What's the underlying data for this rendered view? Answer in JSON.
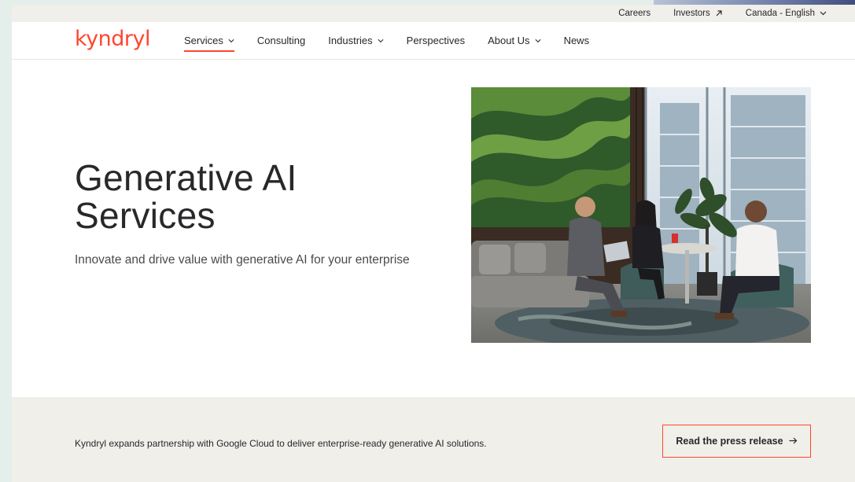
{
  "utility_nav": {
    "careers": "Careers",
    "investors": "Investors",
    "locale": "Canada - English"
  },
  "brand": {
    "logo_text": "kyndryl"
  },
  "main_nav": {
    "items": [
      {
        "label": "Services"
      },
      {
        "label": "Consulting"
      },
      {
        "label": "Industries"
      },
      {
        "label": "Perspectives"
      },
      {
        "label": "About Us"
      },
      {
        "label": "News"
      }
    ]
  },
  "hero": {
    "title_line1": "Generative AI",
    "title_line2": "Services",
    "subtitle": "Innovate and drive value with generative AI for your enterprise"
  },
  "banner": {
    "text": "Kyndryl expands partnership with Google Cloud to deliver enterprise-ready generative AI solutions.",
    "button_label": "Read the press release"
  },
  "colors": {
    "brand_accent": "#ff462d",
    "text": "#29272a",
    "utility_bg": "#f0efea"
  }
}
